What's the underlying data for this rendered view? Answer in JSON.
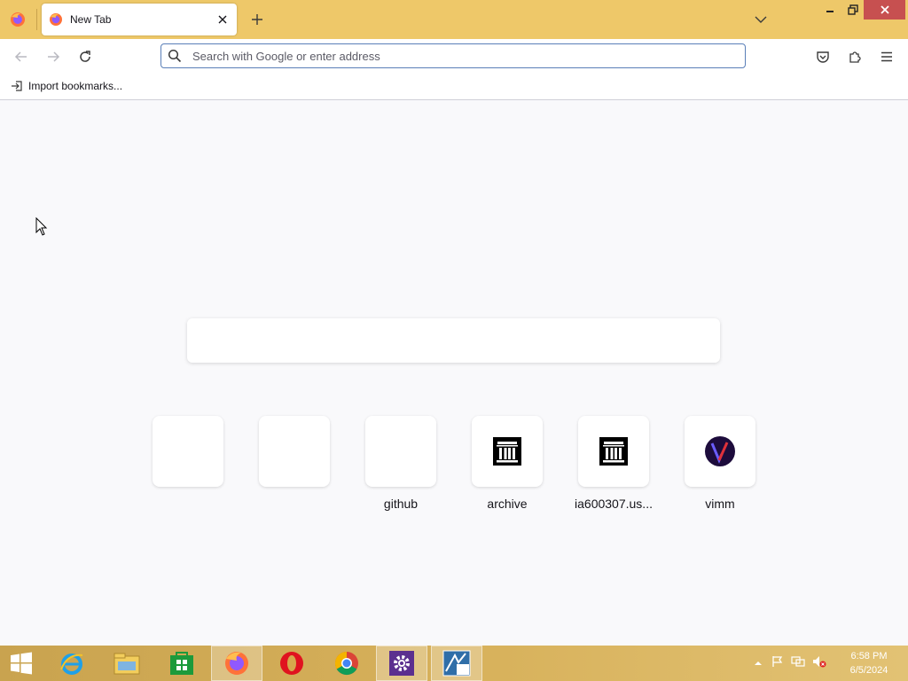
{
  "browser": {
    "tab": {
      "title": "New Tab"
    },
    "urlbar": {
      "placeholder": "Search with Google or enter address",
      "value": ""
    },
    "bookmarks": {
      "import_label": "Import bookmarks..."
    }
  },
  "shortcuts": [
    {
      "label": "",
      "icon": "blank"
    },
    {
      "label": "",
      "icon": "blank"
    },
    {
      "label": "github",
      "icon": "blank"
    },
    {
      "label": "archive",
      "icon": "archive-icon"
    },
    {
      "label": "ia600307.us...",
      "icon": "archive-icon"
    },
    {
      "label": "vimm",
      "icon": "vimm-icon"
    }
  ],
  "taskbar": {
    "apps": [
      "start-icon",
      "internet-explorer-icon",
      "file-explorer-icon",
      "store-icon",
      "firefox-icon",
      "opera-icon",
      "chrome-icon",
      "settings-icon",
      "app-10-icon"
    ],
    "clock": {
      "time": "6:58 PM",
      "date": "6/5/2024"
    }
  },
  "colors": {
    "titlebar": "#eec869",
    "close": "#c75050",
    "accent": "#5a7fb8"
  }
}
